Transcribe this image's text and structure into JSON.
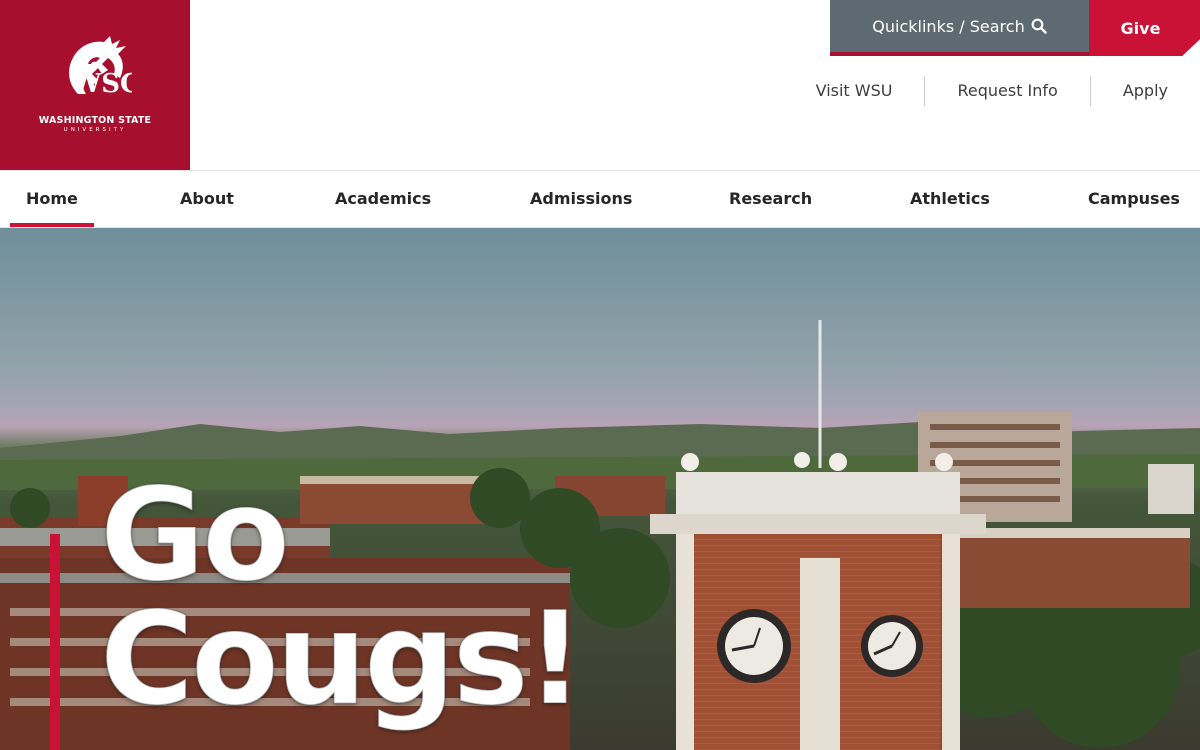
{
  "brand": {
    "name": "WASHINGTON STATE",
    "sub": "UNIVERSITY",
    "primary_color": "#a60f2d",
    "accent_color": "#ca1237"
  },
  "top_bar": {
    "quicklinks_label": "Quicklinks / Search",
    "give_label": "Give"
  },
  "utility_nav": [
    {
      "label": "Visit WSU"
    },
    {
      "label": "Request Info"
    },
    {
      "label": "Apply"
    }
  ],
  "main_nav": [
    {
      "label": "Home",
      "active": true
    },
    {
      "label": "About"
    },
    {
      "label": "Academics"
    },
    {
      "label": "Admissions"
    },
    {
      "label": "Research"
    },
    {
      "label": "Athletics"
    },
    {
      "label": "Campuses"
    }
  ],
  "hero": {
    "headline_line1": "Go",
    "headline_line2": "Cougs!"
  },
  "icons": [
    "cougar-head-logo-icon",
    "search-icon"
  ]
}
